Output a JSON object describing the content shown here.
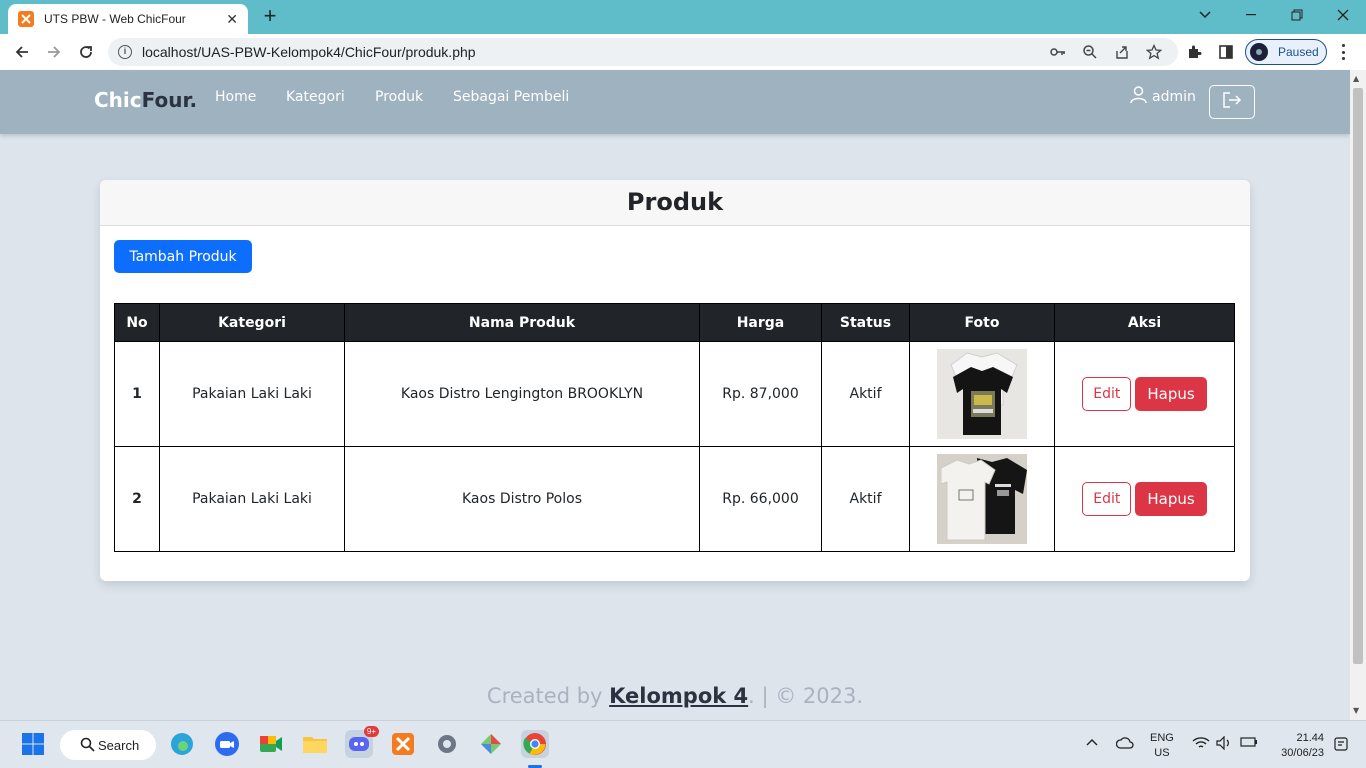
{
  "browser": {
    "tab_title": "UTS PBW - Web ChicFour",
    "url": "localhost/UAS-PBW-Kelompok4/ChicFour/produk.php",
    "profile_status": "Paused"
  },
  "site": {
    "brand_part1": "Chic",
    "brand_part2": "Four.",
    "nav": [
      "Home",
      "Kategori",
      "Produk",
      "Sebagai Pembeli"
    ],
    "user": "admin"
  },
  "page": {
    "title": "Produk",
    "add_button": "Tambah Produk",
    "columns": [
      "No",
      "Kategori",
      "Nama Produk",
      "Harga",
      "Status",
      "Foto",
      "Aksi"
    ],
    "rows": [
      {
        "no": "1",
        "kategori": "Pakaian Laki Laki",
        "nama": "Kaos Distro Lengington BROOKLYN",
        "harga": "Rp. 87,000",
        "status": "Aktif"
      },
      {
        "no": "2",
        "kategori": "Pakaian Laki Laki",
        "nama": "Kaos Distro Polos",
        "harga": "Rp. 66,000",
        "status": "Aktif"
      }
    ],
    "edit_label": "Edit",
    "delete_label": "Hapus"
  },
  "footer": {
    "prefix": "Created by ",
    "author": "Kelompok 4",
    "suffix": ". | © 2023."
  },
  "taskbar": {
    "search": "Search",
    "lang1": "ENG",
    "lang2": "US",
    "time": "21.44",
    "date": "30/06/23",
    "discord_badge": "9+"
  }
}
